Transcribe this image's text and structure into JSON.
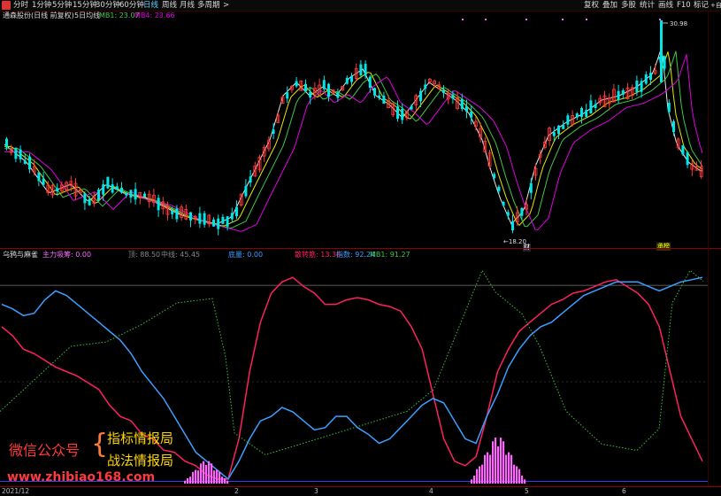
{
  "toolbar": {
    "timeframes": [
      "分时",
      "1分钟",
      "5分钟",
      "15分钟",
      "30分钟",
      "60分钟",
      "日线",
      "周线",
      "月线",
      "多周期"
    ],
    "active_timeframe": "日线",
    "more": ">",
    "right_buttons": [
      "复权",
      "叠加",
      "多股",
      "统计",
      "画线",
      "F10",
      "标记",
      "+自"
    ]
  },
  "main": {
    "title": "通森股份(日线 前复权)",
    "indicator": "5日均线",
    "mb1": "MB1: 23.07",
    "mb4": "MB4: 23.66",
    "high_label": "30.98",
    "low_label": "←18.20",
    "marker_bottom_1": "财",
    "marker_bottom_2": "承榜"
  },
  "sub": {
    "title": "乌鸦与麻雀",
    "l1": "主力吸筹: 0.00",
    "l2": "顶: 88.50",
    "l3": "中线: 45.45",
    "l4": "底量: 0.00",
    "l5": "散转筋: 13.38",
    "l6": "指数: 92.24",
    "l7": "MB1: 91.27"
  },
  "axis": {
    "labels": [
      "2021/12",
      "2",
      "3",
      "4",
      "5",
      "6"
    ]
  },
  "watermark": {
    "wechat": "微信公众号",
    "line1": "指标情报局",
    "line2": "战法情报局",
    "url": "www.zhibiao168.com"
  },
  "colors": {
    "bg": "#000000",
    "up": "#ff3a3a",
    "down": "#00e5e5",
    "ma5": "#e8e8e8",
    "ma_yellow": "#e8e800",
    "ma_magenta": "#e000e0",
    "ma_green": "#3cc84a",
    "red_line": "#ff2060",
    "blue_line": "#3aa0ff",
    "green_dotted": "#3cbf3c",
    "pink_bar": "#ff66ff"
  },
  "chart_data": {
    "type": "line",
    "price_series": {
      "high": 30.98,
      "low": 18.2
    },
    "oscillator": {
      "series": [
        {
          "name": "散转筋",
          "values": [
            70,
            66,
            60,
            58,
            55,
            52,
            50,
            48,
            45,
            42,
            35,
            30,
            28,
            22,
            20,
            15,
            14,
            10,
            8,
            4,
            2,
            2,
            20,
            50,
            72,
            85,
            90,
            92,
            88,
            85,
            80,
            80,
            82,
            83,
            82,
            80,
            79,
            77,
            70,
            60,
            40,
            20,
            10,
            8,
            12,
            30,
            50,
            60,
            68,
            72,
            76,
            80,
            82,
            85,
            86,
            88,
            90,
            91,
            88,
            85,
            80,
            70,
            50,
            30,
            20,
            10
          ]
        },
        {
          "name": "指数",
          "values": [
            80,
            78,
            75,
            76,
            82,
            86,
            84,
            80,
            76,
            72,
            68,
            64,
            58,
            50,
            44,
            38,
            30,
            22,
            14,
            10,
            6,
            2,
            10,
            20,
            28,
            30,
            34,
            32,
            28,
            24,
            25,
            30,
            30,
            25,
            22,
            18,
            20,
            25,
            30,
            35,
            38,
            36,
            28,
            20,
            18,
            30,
            40,
            52,
            60,
            66,
            70,
            72,
            76,
            80,
            84,
            86,
            88,
            90,
            90,
            90,
            88,
            86,
            88,
            90,
            91,
            92
          ]
        }
      ]
    }
  }
}
